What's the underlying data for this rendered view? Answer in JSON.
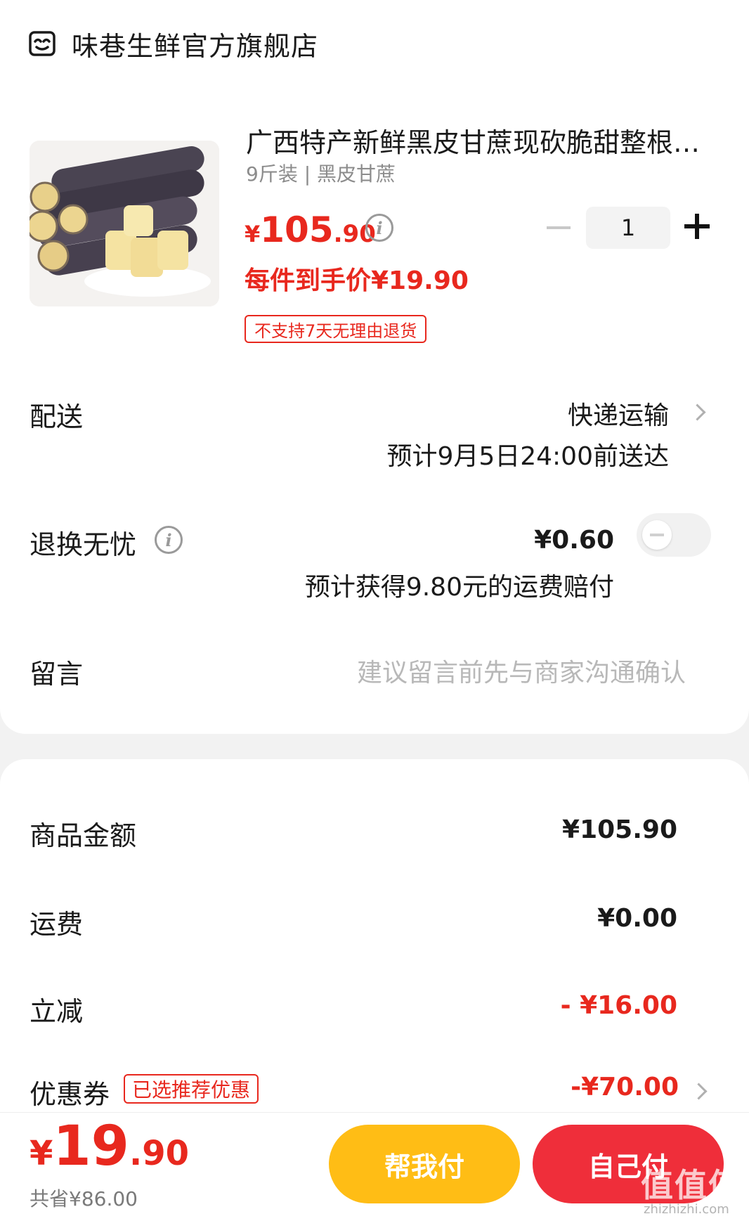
{
  "store": {
    "name": "味巷生鲜官方旗舰店"
  },
  "product": {
    "title": "广西特产新鲜黑皮甘蔗现砍脆甜整根…",
    "spec": "9斤装 | 黑皮甘蔗",
    "price_currency": "¥",
    "price_int": "105",
    "price_dec": ".90",
    "quantity": "1",
    "unit_price": "每件到手价¥19.90",
    "no_return_tag": "不支持7天无理由退货"
  },
  "delivery": {
    "label": "配送",
    "method": "快递运输",
    "eta": "预计9月5日24:00前送达"
  },
  "return_service": {
    "label": "退换无忧",
    "price": "¥0.60",
    "note": "预计获得9.80元的运费赔付",
    "enabled": false
  },
  "message": {
    "label": "留言",
    "placeholder": "建议留言前先与商家沟通确认"
  },
  "summary": {
    "goods_label": "商品金额",
    "goods_value": "¥105.90",
    "shipping_label": "运费",
    "shipping_value": "¥0.00",
    "discount_label": "立减",
    "discount_value": "- ¥16.00",
    "coupon_label": "优惠券",
    "coupon_tag": "已选推荐优惠",
    "coupon_value": "-¥70.00"
  },
  "footer": {
    "total_currency": "¥",
    "total_int": "19",
    "total_dec": ".90",
    "saved": "共省¥86.00",
    "help_pay_label": "帮我付",
    "self_pay_label": "自己付"
  },
  "watermark": {
    "text": "值值值",
    "url": "zhizhizhi.com"
  },
  "colors": {
    "accent_red": "#e8281e",
    "help_pay": "#ffbd15",
    "self_pay": "#ef2e3a"
  },
  "icons": [
    "store-icon",
    "info-icon",
    "chevron-right-icon",
    "minus-icon",
    "plus-icon"
  ]
}
